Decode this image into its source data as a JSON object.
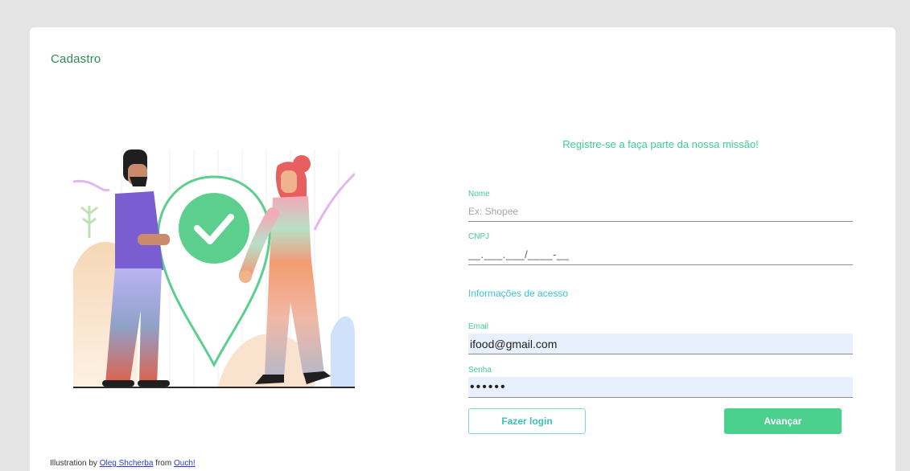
{
  "page": {
    "title": "Cadastro"
  },
  "form": {
    "heading": "Registre-se a faça parte da nossa missão!",
    "nome": {
      "label": "Nome",
      "placeholder": "Ex: Shopee",
      "value": ""
    },
    "cnpj": {
      "label": "CNPJ",
      "value": "__.___.___/____-__"
    },
    "access_section": "Informações de acesso",
    "email": {
      "label": "Email",
      "value": "ifood@gmail.com"
    },
    "senha": {
      "label": "Senha",
      "value": "••••••"
    },
    "login_button": "Fazer login",
    "next_button": "Avançar"
  },
  "credit": {
    "prefix": "Illustration by ",
    "author": "Oleg Shcherba",
    "middle": " from ",
    "source": "Ouch!"
  },
  "colors": {
    "background": "#e4e4e4",
    "accent_green": "#3ccf8e",
    "button_green": "#4cd08e",
    "section_cyan": "#3cc0d8",
    "autofill_blue": "#e8f0fe"
  }
}
